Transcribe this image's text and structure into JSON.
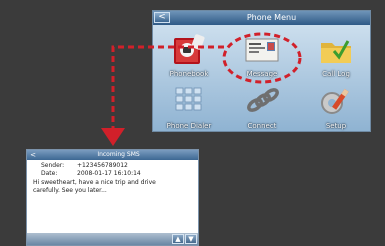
{
  "phone_menu": {
    "back_glyph": "<",
    "title": "Phone Menu",
    "items": [
      {
        "label": "Phonebook",
        "icon": "phonebook-icon"
      },
      {
        "label": "Message",
        "icon": "message-icon"
      },
      {
        "label": "Call Log",
        "icon": "call-log-icon"
      },
      {
        "label": "Phone Dialer",
        "icon": "dialer-icon"
      },
      {
        "label": "Connect",
        "icon": "connect-icon"
      },
      {
        "label": "Setup",
        "icon": "setup-icon"
      }
    ]
  },
  "sms": {
    "back_glyph": "<",
    "title": "Incoming SMS",
    "sender_label": "Sender:",
    "sender_value": "+123456789012",
    "date_label": "Date:",
    "date_value": "2008-01-17 16:10:14",
    "message": "Hi sweetheart, have a nice trip and drive carefully. See you later...",
    "scroll_up_glyph": "▲",
    "scroll_down_glyph": "▼"
  },
  "colors": {
    "annotation": "#d1202a"
  }
}
